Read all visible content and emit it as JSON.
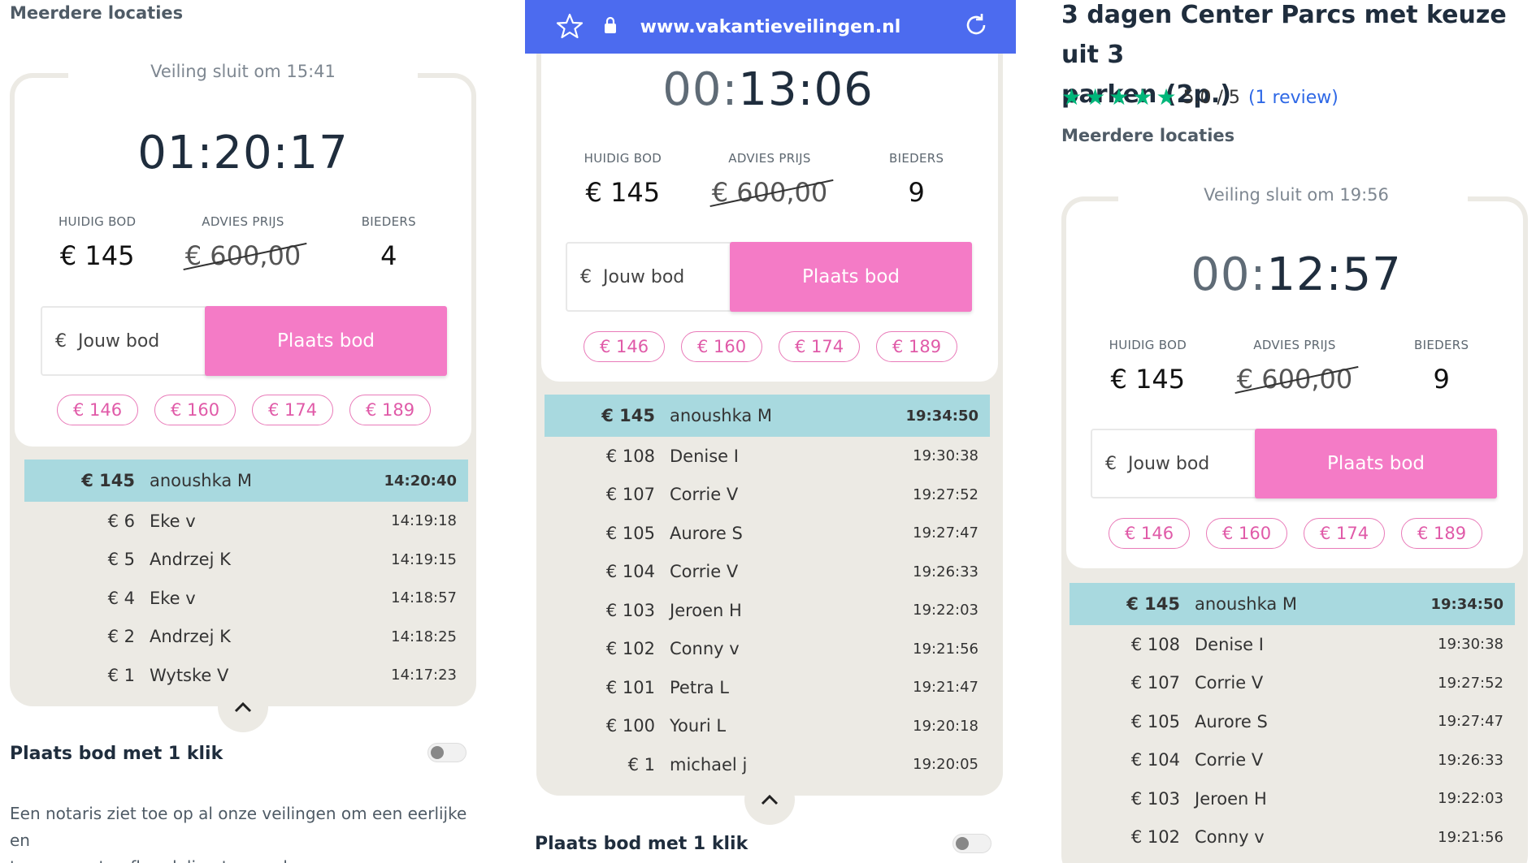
{
  "panel1": {
    "locations_title": "Meerdere locaties",
    "closes_at": "Veiling sluit om 15:41",
    "timer_dim": "",
    "timer_main": "01:20:17",
    "stats": {
      "current_label": "HUIDIG BOD",
      "current_value": "€ 145",
      "advice_label": "ADVIES PRIJS",
      "advice_value": "€ 600,00",
      "bidders_label": "BIEDERS",
      "bidders_value": "4"
    },
    "bid_input_currency": "€",
    "bid_input_placeholder": "Jouw bod",
    "bid_button": "Plaats bod",
    "quick_bids": [
      "€ 146",
      "€ 160",
      "€ 174",
      "€ 189"
    ],
    "bids": [
      {
        "amount": "€ 145",
        "name": "anoushka M",
        "time": "14:20:40"
      },
      {
        "amount": "€ 6",
        "name": "Eke v",
        "time": "14:19:18"
      },
      {
        "amount": "€ 5",
        "name": "Andrzej K",
        "time": "14:19:15"
      },
      {
        "amount": "€ 4",
        "name": "Eke v",
        "time": "14:18:57"
      },
      {
        "amount": "€ 2",
        "name": "Andrzej K",
        "time": "14:18:25"
      },
      {
        "amount": "€ 1",
        "name": "Wytske V",
        "time": "14:17:23"
      }
    ],
    "one_click_label": "Plaats bod met 1 klik",
    "notary_text_1": "Een notaris ziet toe op al onze veilingen om een eerlijke en",
    "notary_text_2": "transparante afhandeling te waarborgen."
  },
  "panel2": {
    "url": "www.vakantieveilingen.nl",
    "timer_dim": "00:",
    "timer_main": "13:06",
    "stats": {
      "current_label": "HUIDIG BOD",
      "current_value": "€ 145",
      "advice_label": "ADVIES PRIJS",
      "advice_value": "€ 600,00",
      "bidders_label": "BIEDERS",
      "bidders_value": "9"
    },
    "bid_input_currency": "€",
    "bid_input_placeholder": "Jouw bod",
    "bid_button": "Plaats bod",
    "quick_bids": [
      "€ 146",
      "€ 160",
      "€ 174",
      "€ 189"
    ],
    "bids": [
      {
        "amount": "€ 145",
        "name": "anoushka M",
        "time": "19:34:50"
      },
      {
        "amount": "€ 108",
        "name": "Denise I",
        "time": "19:30:38"
      },
      {
        "amount": "€ 107",
        "name": "Corrie V",
        "time": "19:27:52"
      },
      {
        "amount": "€ 105",
        "name": "Aurore S",
        "time": "19:27:47"
      },
      {
        "amount": "€ 104",
        "name": "Corrie V",
        "time": "19:26:33"
      },
      {
        "amount": "€ 103",
        "name": "Jeroen H",
        "time": "19:22:03"
      },
      {
        "amount": "€ 102",
        "name": "Conny v",
        "time": "19:21:56"
      },
      {
        "amount": "€ 101",
        "name": "Petra L",
        "time": "19:21:47"
      },
      {
        "amount": "€ 100",
        "name": "Youri L",
        "time": "19:20:18"
      },
      {
        "amount": "€ 1",
        "name": "michael j",
        "time": "19:20:05"
      }
    ],
    "one_click_label": "Plaats bod met 1 klik"
  },
  "panel3": {
    "heading_line1": "3 dagen Center Parcs met keuze uit 3",
    "heading_line2": "parken (2p.)",
    "rating_text": "5.0 / 5",
    "rating_stars": 5,
    "review_link": "(1 review)",
    "locations_title": "Meerdere locaties",
    "closes_at": "Veiling sluit om 19:56",
    "timer_dim": "00:",
    "timer_main": "12:57",
    "stats": {
      "current_label": "HUIDIG BOD",
      "current_value": "€ 145",
      "advice_label": "ADVIES PRIJS",
      "advice_value": "€ 600,00",
      "bidders_label": "BIEDERS",
      "bidders_value": "9"
    },
    "bid_input_currency": "€",
    "bid_input_placeholder": "Jouw bod",
    "bid_button": "Plaats bod",
    "quick_bids": [
      "€ 146",
      "€ 160",
      "€ 174",
      "€ 189"
    ],
    "bids": [
      {
        "amount": "€ 145",
        "name": "anoushka M",
        "time": "19:34:50"
      },
      {
        "amount": "€ 108",
        "name": "Denise I",
        "time": "19:30:38"
      },
      {
        "amount": "€ 107",
        "name": "Corrie V",
        "time": "19:27:52"
      },
      {
        "amount": "€ 105",
        "name": "Aurore S",
        "time": "19:27:47"
      },
      {
        "amount": "€ 104",
        "name": "Corrie V",
        "time": "19:26:33"
      },
      {
        "amount": "€ 103",
        "name": "Jeroen H",
        "time": "19:22:03"
      },
      {
        "amount": "€ 102",
        "name": "Conny v",
        "time": "19:21:56"
      }
    ]
  },
  "colors": {
    "accent_pink": "#f47bc6",
    "browser_blue": "#4c6bef",
    "highlight_row": "#a8d9df",
    "star_green": "#00b67a",
    "link_blue": "#2e68e6"
  }
}
